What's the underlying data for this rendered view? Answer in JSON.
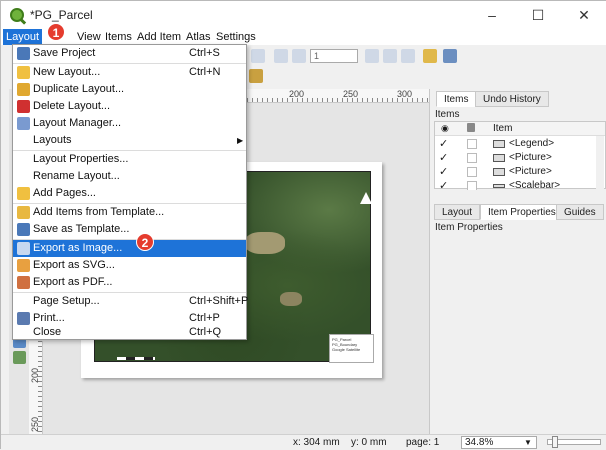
{
  "window": {
    "title": "*PG_Parcel",
    "controls": {
      "minimize": "–",
      "maximize": "☐",
      "close": "✕"
    }
  },
  "menubar": {
    "items": [
      {
        "label": "Layout",
        "active": true
      },
      {
        "label": "View"
      },
      {
        "label": "Items"
      },
      {
        "label": "Add Item"
      },
      {
        "label": "Atlas"
      },
      {
        "label": "Settings"
      }
    ]
  },
  "toolbar": {
    "page_spin_value": "1"
  },
  "layout_menu": {
    "items": [
      {
        "label": "Save Project",
        "shortcut": "Ctrl+S",
        "icon": "save-icon"
      },
      {
        "label": "New Layout...",
        "shortcut": "Ctrl+N",
        "icon": "new-layout-icon"
      },
      {
        "label": "Duplicate Layout...",
        "shortcut": "",
        "icon": "duplicate-icon"
      },
      {
        "label": "Delete Layout...",
        "shortcut": "",
        "icon": "delete-icon"
      },
      {
        "label": "Layout Manager...",
        "shortcut": "",
        "icon": "layout-manager-icon"
      },
      {
        "label": "Layouts",
        "shortcut": "",
        "icon": "",
        "submenu": true
      },
      {
        "label": "Layout Properties...",
        "shortcut": "",
        "icon": ""
      },
      {
        "label": "Rename Layout...",
        "shortcut": "",
        "icon": ""
      },
      {
        "label": "Add Pages...",
        "shortcut": "",
        "icon": "add-pages-icon"
      },
      {
        "label": "Add Items from Template...",
        "shortcut": "",
        "icon": "folder-icon"
      },
      {
        "label": "Save as Template...",
        "shortcut": "",
        "icon": "save-template-icon"
      },
      {
        "label": "Export as Image...",
        "shortcut": "",
        "icon": "export-image-icon",
        "highlighted": true
      },
      {
        "label": "Export as SVG...",
        "shortcut": "",
        "icon": "export-svg-icon"
      },
      {
        "label": "Export as PDF...",
        "shortcut": "",
        "icon": "export-pdf-icon"
      },
      {
        "label": "Page Setup...",
        "shortcut": "Ctrl+Shift+P",
        "icon": ""
      },
      {
        "label": "Print...",
        "shortcut": "Ctrl+P",
        "icon": "print-icon"
      },
      {
        "label": "Close",
        "shortcut": "Ctrl+Q",
        "icon": ""
      }
    ]
  },
  "annotations": {
    "badge1": "1",
    "badge2": "2"
  },
  "ruler": {
    "h_ticks": [
      "200",
      "250",
      "300"
    ],
    "v_ticks": [
      "200",
      "250"
    ]
  },
  "map": {
    "legend_lines": [
      "PG_Parcel",
      "PG_Boundary",
      "Google Satellite"
    ]
  },
  "panel": {
    "top_tabs": [
      "Items",
      "Undo History"
    ],
    "items_title": "Items",
    "items_column": "Item",
    "items": [
      {
        "name": "<Legend>",
        "checked": "✓"
      },
      {
        "name": "<Picture>",
        "checked": "✓"
      },
      {
        "name": "<Picture>",
        "checked": "✓"
      },
      {
        "name": "<Scalebar>",
        "checked": "✓"
      }
    ],
    "bottom_tabs": [
      "Layout",
      "Item Properties",
      "Guides"
    ],
    "item_properties_title": "Item Properties"
  },
  "statusbar": {
    "x": "x: 304 mm",
    "y": "y: 0 mm",
    "page": "page: 1",
    "zoom": "34.8%"
  },
  "colors": {
    "accent": "#1e73d8",
    "badge": "#e53c2e"
  }
}
